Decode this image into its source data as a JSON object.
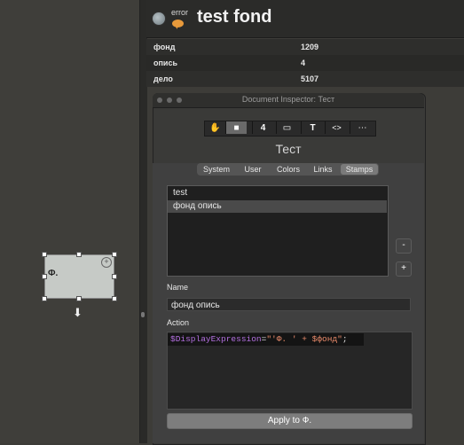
{
  "canvas": {
    "shape_label": "Ф.",
    "shape_plus": "+"
  },
  "header": {
    "status_label": "error",
    "title": "test fond"
  },
  "info": [
    {
      "key": "фонд",
      "value": "1209"
    },
    {
      "key": "опись",
      "value": "4"
    },
    {
      "key": "дело",
      "value": "5107"
    }
  ],
  "inspector": {
    "window_title": "Document Inspector: Тест",
    "object_name": "Тест",
    "toolbar": [
      {
        "icon": "hand-icon",
        "glyph": "✋"
      },
      {
        "icon": "square-icon",
        "glyph": "■"
      },
      {
        "icon": "four-icon",
        "glyph": "4"
      },
      {
        "icon": "gradient-icon",
        "glyph": "▭"
      },
      {
        "icon": "text-icon",
        "glyph": "T"
      },
      {
        "icon": "code-icon",
        "glyph": "<>"
      },
      {
        "icon": "more-icon",
        "glyph": "⋯"
      }
    ],
    "tabs": [
      "System",
      "User",
      "Colors",
      "Links",
      "Stamps"
    ],
    "active_tab": "Stamps",
    "stamps": [
      {
        "label": "test",
        "selected": false
      },
      {
        "label": "фонд опись",
        "selected": true
      }
    ],
    "remove_label": "-",
    "add_label": "+",
    "name_label": "Name",
    "name_value": "фонд опись",
    "action_label": "Action",
    "action_code": {
      "var": "$DisplayExpression",
      "op": "=",
      "str": "\"'Ф. ' + $фонд\"",
      "end": ";"
    },
    "apply_label": "Apply to Ф."
  },
  "colors": {
    "background": "#3d3c38",
    "panel": "#3a3a38",
    "accent_error": "#e89a3b"
  }
}
